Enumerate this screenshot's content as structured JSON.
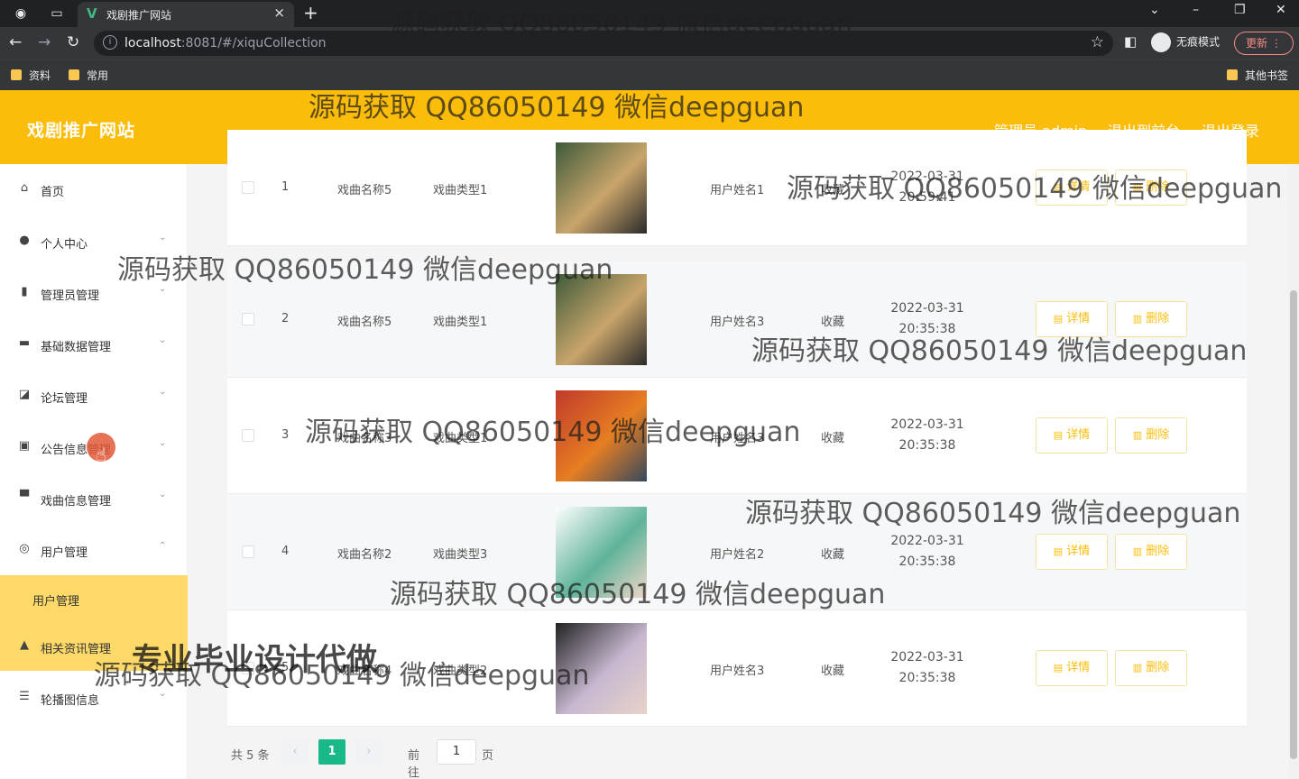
{
  "browser": {
    "tab_title": "戏剧推广网站",
    "url_host": "localhost",
    "url_rest": ":8081/#/xiquCollection",
    "incognito_label": "无痕模式",
    "update_label": "更新",
    "bookmarks": [
      "资料",
      "常用"
    ],
    "other_bookmarks": "其他书签"
  },
  "header": {
    "brand": "戏剧推广网站",
    "admin": "管理员 admin",
    "to_front": "退出到前台",
    "logout": "退出登录",
    "color": "#fbbd0a"
  },
  "sidebar": {
    "items": [
      {
        "label": "首页",
        "icon": "home-icon"
      },
      {
        "label": "个人中心",
        "icon": "user-icon"
      },
      {
        "label": "管理员管理",
        "icon": "bar-chart-icon"
      },
      {
        "label": "基础数据管理",
        "icon": "monitor-icon"
      },
      {
        "label": "论坛管理",
        "icon": "trend-icon"
      },
      {
        "label": "公告信息管理",
        "icon": "clipboard-icon"
      },
      {
        "label": "戏曲信息管理",
        "icon": "display-icon"
      },
      {
        "label": "用户管理",
        "icon": "compass-icon"
      },
      {
        "label": "相关资讯管理",
        "icon": "person-icon"
      },
      {
        "label": "轮播图信息",
        "icon": "layers-icon"
      }
    ],
    "active_sub": "用户管理"
  },
  "table": {
    "rows": [
      {
        "index": "1",
        "name": "戏曲名称5",
        "type": "戏曲类型1",
        "user": "用户姓名1",
        "kind": "收藏",
        "date": "2022-03-31",
        "time": "20:59:41"
      },
      {
        "index": "2",
        "name": "戏曲名称5",
        "type": "戏曲类型1",
        "user": "用户姓名3",
        "kind": "收藏",
        "date": "2022-03-31",
        "time": "20:35:38"
      },
      {
        "index": "3",
        "name": "戏曲名称3",
        "type": "戏曲类型1",
        "user": "用户姓名3",
        "kind": "收藏",
        "date": "2022-03-31",
        "time": "20:35:38"
      },
      {
        "index": "4",
        "name": "戏曲名称2",
        "type": "戏曲类型3",
        "user": "用户姓名2",
        "kind": "收藏",
        "date": "2022-03-31",
        "time": "20:35:38"
      },
      {
        "index": "5",
        "name": "戏曲名称4",
        "type": "戏曲类型2",
        "user": "用户姓名3",
        "kind": "收藏",
        "date": "2022-03-31",
        "time": "20:35:38"
      }
    ],
    "detail_label": "详情",
    "delete_label": "删除"
  },
  "pager": {
    "total": "共 5 条",
    "current": "1",
    "goto": "前往",
    "goto_value": "1",
    "page_suffix": "页"
  },
  "watermarks": {
    "text": "源码获取 QQ86050149 微信deepguan",
    "big": "专业毕业设计代做"
  }
}
